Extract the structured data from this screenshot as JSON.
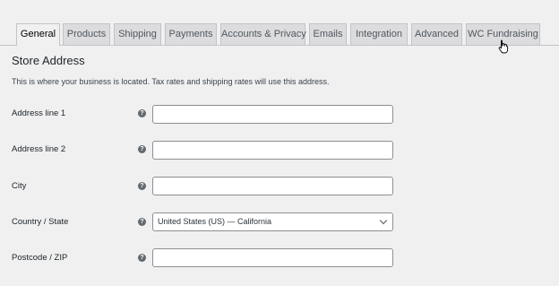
{
  "tabs": [
    {
      "label": "General",
      "active": true
    },
    {
      "label": "Products"
    },
    {
      "label": "Shipping"
    },
    {
      "label": "Payments"
    },
    {
      "label": "Accounts & Privacy"
    },
    {
      "label": "Emails"
    },
    {
      "label": "Integration"
    },
    {
      "label": "Advanced"
    },
    {
      "label": "WC Fundraising"
    }
  ],
  "section": {
    "title": "Store Address",
    "description": "This is where your business is located. Tax rates and shipping rates will use this address."
  },
  "fields": {
    "address1": {
      "label": "Address line 1",
      "value": ""
    },
    "address2": {
      "label": "Address line 2",
      "value": ""
    },
    "city": {
      "label": "City",
      "value": ""
    },
    "country": {
      "label": "Country / State",
      "value": "United States (US) — California"
    },
    "postcode": {
      "label": "Postcode / ZIP",
      "value": ""
    }
  },
  "help_icon": "question-circle-icon",
  "cursor_icon": "hand-pointer-icon"
}
